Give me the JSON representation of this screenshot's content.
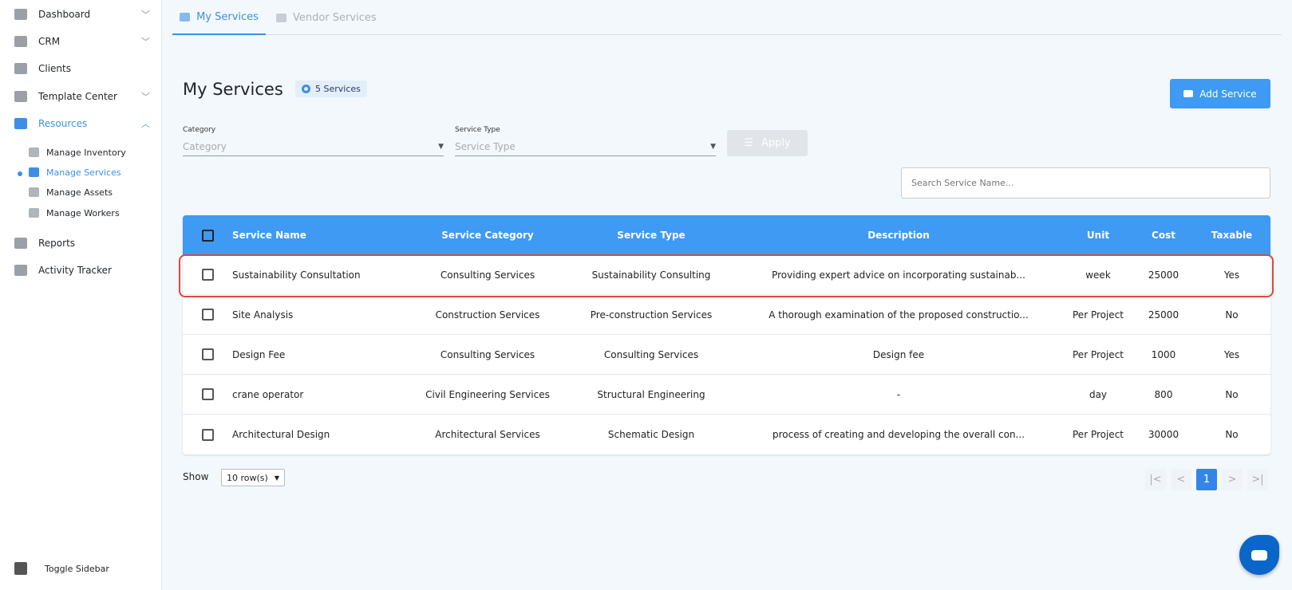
{
  "sidebar": {
    "items": [
      {
        "label": "Dashboard"
      },
      {
        "label": "CRM"
      },
      {
        "label": "Clients"
      },
      {
        "label": "Template Center"
      },
      {
        "label": "Resources"
      },
      {
        "label": "Reports"
      },
      {
        "label": "Activity Tracker"
      }
    ],
    "sub_items": [
      {
        "label": "Manage Inventory"
      },
      {
        "label": "Manage Services"
      },
      {
        "label": "Manage Assets"
      },
      {
        "label": "Manage Workers"
      }
    ],
    "toggle": "Toggle Sidebar"
  },
  "tabs": [
    {
      "label": "My Services"
    },
    {
      "label": "Vendor Services"
    }
  ],
  "page": {
    "title": "My Services",
    "count_badge": "5 Services",
    "add_button": "Add Service"
  },
  "filters": {
    "category_label": "Category",
    "category_placeholder": "Category",
    "type_label": "Service Type",
    "type_placeholder": "Service Type",
    "apply": "Apply",
    "search_placeholder": "Search Service Name..."
  },
  "table": {
    "headers": [
      "Service Name",
      "Service Category",
      "Service Type",
      "Description",
      "Unit",
      "Cost",
      "Taxable"
    ],
    "rows": [
      [
        "Sustainability Consultation",
        "Consulting Services",
        "Sustainability Consulting",
        "Providing expert advice on incorporating sustainab...",
        "week",
        "25000",
        "Yes"
      ],
      [
        "Site Analysis",
        "Construction Services",
        "Pre-construction Services",
        "A thorough examination of the proposed constructio...",
        "Per Project",
        "25000",
        "No"
      ],
      [
        "Design Fee",
        "Consulting Services",
        "Consulting Services",
        "Design fee",
        "Per Project",
        "1000",
        "Yes"
      ],
      [
        "crane operator",
        "Civil Engineering Services",
        "Structural Engineering",
        "-",
        "day",
        "800",
        "No"
      ],
      [
        "Architectural Design",
        "Architectural Services",
        "Schematic Design",
        "process of creating and developing the overall con...",
        "Per Project",
        "30000",
        "No"
      ]
    ]
  },
  "pagination": {
    "show_label": "Show",
    "rows_per_page": "10 row(s)",
    "current_page": "1",
    "first": "|<",
    "prev": "<",
    "next": ">",
    "last": ">|"
  },
  "colors": {
    "accent": "#3e9af2",
    "highlight": "#e0473c"
  }
}
